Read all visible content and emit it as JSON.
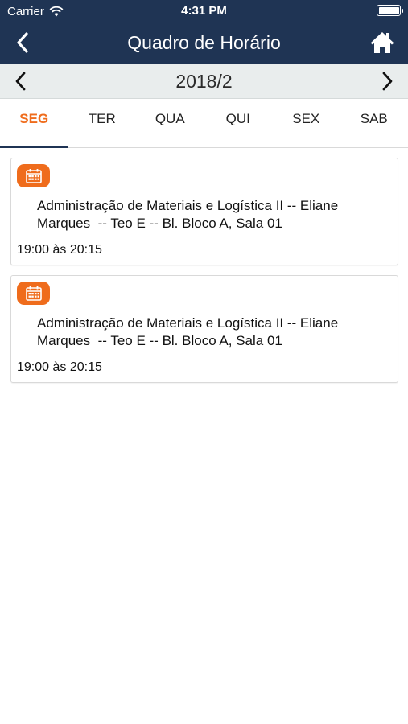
{
  "status_bar": {
    "carrier": "Carrier",
    "time": "4:31 PM"
  },
  "nav": {
    "title": "Quadro de Horário",
    "back_icon": "chevron-left-icon",
    "home_icon": "home-icon"
  },
  "period": {
    "label": "2018/2"
  },
  "tabs": [
    {
      "label": "SEG",
      "active": true
    },
    {
      "label": "TER",
      "active": false
    },
    {
      "label": "QUA",
      "active": false
    },
    {
      "label": "QUI",
      "active": false
    },
    {
      "label": "SEX",
      "active": false
    },
    {
      "label": "SAB",
      "active": false
    }
  ],
  "classes": [
    {
      "description": "Administração de Materiais e Logística II -- Eliane Marques  -- Teo E -- Bl. Bloco A, Sala 01",
      "time": "19:00 às 20:15"
    },
    {
      "description": "Administração de Materiais e Logística II -- Eliane Marques  -- Teo E -- Bl. Bloco A, Sala 01",
      "time": "19:00 às 20:15"
    }
  ],
  "colors": {
    "nav_bg": "#1f3454",
    "accent": "#ef6c1c",
    "period_bg": "#e9eded"
  }
}
